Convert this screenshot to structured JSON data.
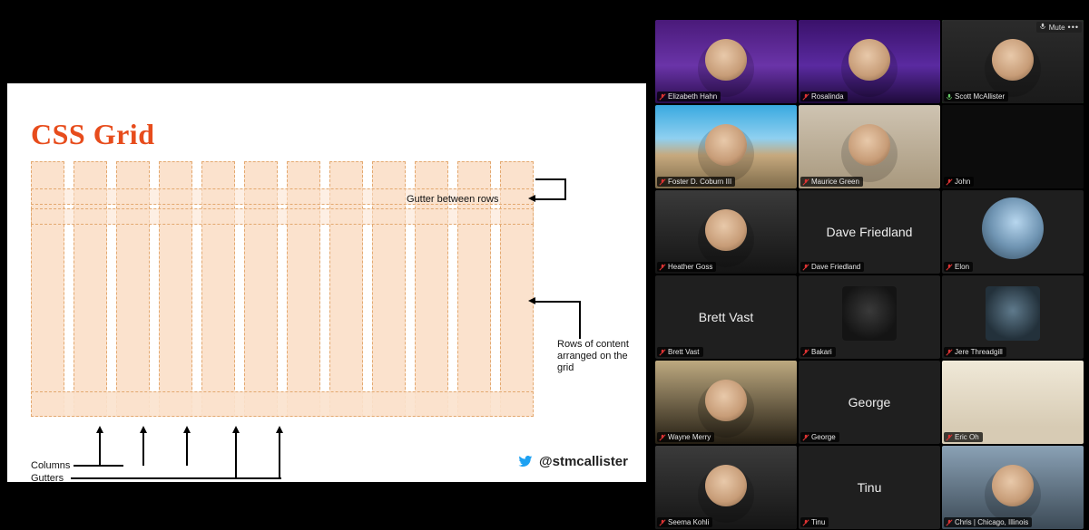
{
  "slide": {
    "title": "CSS Grid",
    "annot_gutter_rows": "Gutter between rows",
    "annot_rows_content": "Rows of content arranged on the grid",
    "annot_columns": "Columns",
    "annot_gutters": "Gutters",
    "twitter_handle": "@stmcallister"
  },
  "mute_button": {
    "label": "Mute",
    "options_glyph": "•••"
  },
  "participants": [
    {
      "name": "Elizabeth Hahn",
      "muted": true,
      "video": "purple",
      "speaker": false,
      "camera_off": false
    },
    {
      "name": "Rosalinda",
      "muted": true,
      "video": "purple2",
      "speaker": false,
      "camera_off": false
    },
    {
      "name": "Scott McAllister",
      "muted": false,
      "video": "room",
      "speaker": true,
      "camera_off": false
    },
    {
      "name": "Foster D. Coburn III",
      "muted": true,
      "video": "beach",
      "speaker": false,
      "camera_off": false
    },
    {
      "name": "Maurice Green",
      "muted": true,
      "video": "livingroom",
      "speaker": false,
      "camera_off": false
    },
    {
      "name": "John",
      "muted": true,
      "video": "dark",
      "speaker": false,
      "camera_off": true
    },
    {
      "name": "Heather Goss",
      "muted": true,
      "video": "office",
      "speaker": false,
      "camera_off": false
    },
    {
      "name": "Dave Friedland",
      "muted": true,
      "video": null,
      "speaker": false,
      "camera_off": true,
      "center_text": "Dave Friedland"
    },
    {
      "name": "Elon",
      "muted": true,
      "video": null,
      "speaker": false,
      "camera_off": true,
      "thumb": "circle"
    },
    {
      "name": "Brett Vast",
      "muted": true,
      "video": null,
      "speaker": false,
      "camera_off": true,
      "center_text": "Brett Vast"
    },
    {
      "name": "Bakari",
      "muted": true,
      "video": null,
      "speaker": false,
      "camera_off": true,
      "thumb": "square-cap"
    },
    {
      "name": "Jere Threadgill",
      "muted": true,
      "video": null,
      "speaker": false,
      "camera_off": true,
      "thumb": "square-outdoor"
    },
    {
      "name": "Wayne Merry",
      "muted": true,
      "video": "suit",
      "speaker": false,
      "camera_off": false
    },
    {
      "name": "George",
      "muted": true,
      "video": null,
      "speaker": false,
      "camera_off": true,
      "center_text": "George"
    },
    {
      "name": "Eric Oh",
      "muted": true,
      "video": "truck",
      "speaker": false,
      "camera_off": false
    },
    {
      "name": "Seema Kohli",
      "muted": true,
      "video": "car",
      "speaker": false,
      "camera_off": false
    },
    {
      "name": "Tinu",
      "muted": true,
      "video": null,
      "speaker": false,
      "camera_off": true,
      "center_text": "Tinu"
    },
    {
      "name": "Chris | Chicago, Illinois",
      "muted": true,
      "video": "city",
      "speaker": false,
      "camera_off": false
    }
  ],
  "colors": {
    "slide_title": "#e74c1c",
    "speaker_outline": "#3bd23b"
  }
}
